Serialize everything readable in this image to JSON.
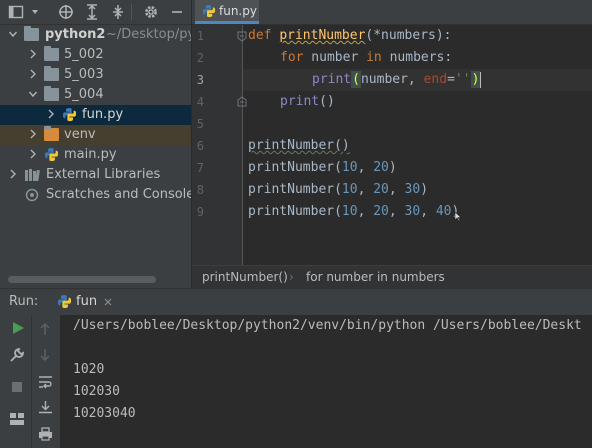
{
  "project": {
    "root": {
      "name": "python2",
      "path": "~/Desktop/pyt"
    },
    "items": [
      {
        "label": "5_002"
      },
      {
        "label": "5_003"
      },
      {
        "label": "5_004"
      },
      {
        "label": "fun.py"
      },
      {
        "label": "venv"
      },
      {
        "label": "main.py"
      },
      {
        "label": "External Libraries"
      },
      {
        "label": "Scratches and Consoles"
      }
    ]
  },
  "editor": {
    "tab": "fun.py",
    "line_numbers": [
      "1",
      "2",
      "3",
      "4",
      "5",
      "6",
      "7",
      "8",
      "9"
    ],
    "code": {
      "l1": {
        "kw": "def",
        "fn": "printNumber",
        "rest": "(*numbers):"
      },
      "l2": {
        "kw1": "for",
        "var": " number ",
        "kw2": "in",
        "rest": " numbers:"
      },
      "l3": {
        "fn": "print",
        "open": "(",
        "arg": "number, ",
        "kwarg": "end",
        "eq": "=",
        "str": "''",
        "close": ")"
      },
      "l4": {
        "fn": "print",
        "rest": "()"
      },
      "l6": "printNumber()",
      "l7": {
        "name": "printNumber(",
        "a": "10",
        "sep1": ", ",
        "b": "20",
        "end": ")"
      },
      "l8": {
        "name": "printNumber(",
        "a": "10",
        "sep1": ", ",
        "b": "20",
        "sep2": ", ",
        "c": "30",
        "end": ")"
      },
      "l9": {
        "name": "printNumber(",
        "a": "10",
        "sep1": ", ",
        "b": "20",
        "sep2": ", ",
        "c": "30",
        "sep3": ", ",
        "d": "40",
        "end": ")"
      }
    },
    "breadcrumb": [
      "printNumber()",
      "for number in numbers"
    ]
  },
  "run": {
    "label": "Run:",
    "tab": "fun",
    "console": [
      "/Users/boblee/Desktop/python2/venv/bin/python /Users/boblee/Deskt",
      "",
      "1020",
      "102030",
      "10203040"
    ]
  },
  "colors": {
    "accent": "#4a88c7",
    "run_green": "#499c54",
    "python_blue": "#3d7ab8",
    "python_yellow": "#f1c93b"
  }
}
